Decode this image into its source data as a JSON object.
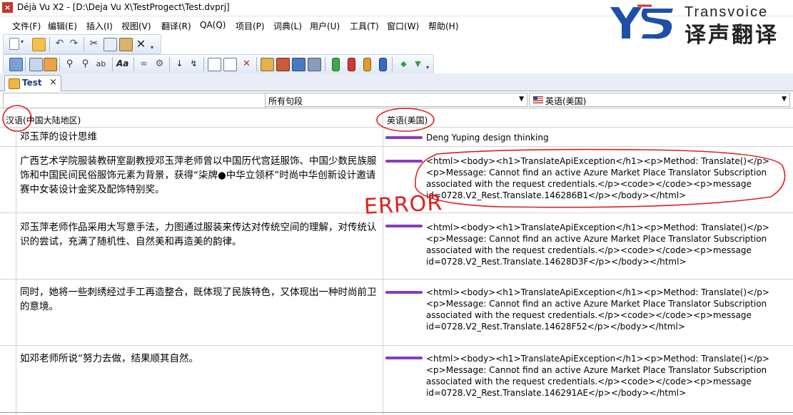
{
  "window": {
    "title": "Déjà Vu X2 - [D:\\Deja Vu X\\TestProgect\\Test.dvprj]",
    "icon": "dejavu-app-icon"
  },
  "logo": {
    "en": "Transvoice",
    "cn": "译声翻译",
    "mark": "YS"
  },
  "menu": {
    "items": [
      {
        "label": "文件(F)"
      },
      {
        "label": "编辑(E)"
      },
      {
        "label": "插入(I)"
      },
      {
        "label": "视图(V)"
      },
      {
        "label": "翻译(R)"
      },
      {
        "label": "QA(Q)"
      },
      {
        "label": "项目(P)"
      },
      {
        "label": "词典(L)"
      },
      {
        "label": "用户(U)"
      },
      {
        "label": "工具(T)"
      },
      {
        "label": "窗口(W)"
      },
      {
        "label": "帮助(H)"
      }
    ]
  },
  "toolbar1": {
    "icons": [
      "new-file-icon",
      "open-folder-icon",
      "undo-icon",
      "redo-icon",
      "cut-icon",
      "copy-icon",
      "paste-icon",
      "delete-icon"
    ]
  },
  "toolbar2": {
    "icons": [
      "project-icon",
      "translate-icon",
      "pretranslate-icon",
      "lookup-icon",
      "search-icon",
      "replace-icon",
      "font-icon",
      "link-icon",
      "unlink-icon",
      "sort-icon",
      "filter-icon",
      "segment-icon",
      "segment-edit-icon",
      "clear-icon",
      "tm-icon",
      "tm-add-icon",
      "tm-remove-icon",
      "tm-settings-icon",
      "bottle-green-icon",
      "bottle-red-icon",
      "bottle-orange-icon",
      "bottle-blue-icon",
      "arrow-up-icon",
      "arrow-down-icon"
    ]
  },
  "tab": {
    "label": "Test",
    "close": "×"
  },
  "filters": {
    "input_value": "",
    "segment_filter": "所有句段",
    "target_language": "英语(美国)"
  },
  "columns": {
    "source": "汉语(中国大陆地区)",
    "target": "英语(美国)"
  },
  "segments": [
    {
      "source": "邓玉萍的设计思维",
      "target": "Deng Yuping design thinking"
    },
    {
      "source": "广西艺术学院服装教研室副教授邓玉萍老师曾以中国历代宫廷服饰、中国少数民族服饰和中国民间民俗服饰元素为背景，获得“柒牌●中华立领杯”时尚中华创新设计邀请赛中女装设计金奖及配饰特别奖。",
      "target": "<html><body><h1>TranslateApiException</h1><p>Method: Translate()</p><p>Message: Cannot find an active Azure Market Place Translator Subscription associated with the request credentials.</p><code></code><p>message id=0728.V2_Rest.Translate.146286B1</p></body></html>"
    },
    {
      "source": "邓玉萍老师作品采用大写意手法，力图通过服装来传达对传统空间的理解，对传统认识的尝试，充满了随机性、自然美和再造美的韵律。",
      "target": "<html><body><h1>TranslateApiException</h1><p>Method: Translate()</p><p>Message: Cannot find an active Azure Market Place Translator Subscription associated with the request credentials.</p><code></code><p>message id=0728.V2_Rest.Translate.14628D3F</p></body></html>"
    },
    {
      "source": "同时，她将一些刺绣经过手工再造整合，既体现了民族特色，又体现出一种时尚前卫的意境。",
      "target": "<html><body><h1>TranslateApiException</h1><p>Method: Translate()</p><p>Message: Cannot find an active Azure Market Place Translator Subscription associated with the request credentials.</p><code></code><p>message id=0728.V2_Rest.Translate.14628F52</p></body></html>"
    },
    {
      "source": "如邓老师所说“努力去做，结果顺其自然。",
      "target": "<html><body><h1>TranslateApiException</h1><p>Method: Translate()</p><p>Message: Cannot find an active Azure Market Place Translator Subscription associated with the request credentials.</p><code></code><p>message id=0728.V2_Rest.Translate.146291AE</p></body></html>"
    }
  ],
  "annotation": {
    "error_label": "ERROR",
    "color": "#e02020"
  },
  "colors": {
    "status_bar": "#8a3cc0",
    "annotation": "#e02020",
    "logo_blue": "#1e4fa8"
  }
}
